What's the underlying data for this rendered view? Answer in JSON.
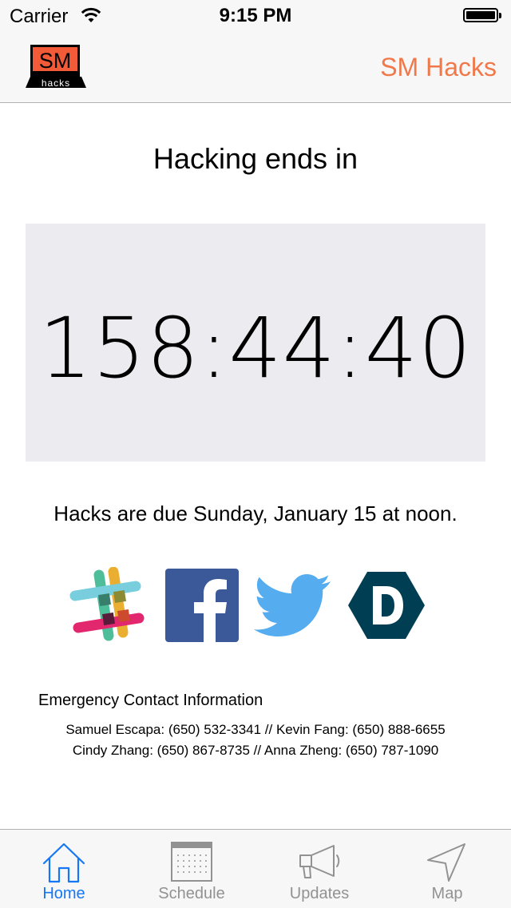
{
  "status_bar": {
    "carrier": "Carrier",
    "time": "9:15 PM"
  },
  "nav": {
    "logo_top": "SM",
    "logo_bottom": "hacks",
    "title": "SM Hacks"
  },
  "main": {
    "heading": "Hacking ends in",
    "countdown": "158:44:40",
    "due_text": "Hacks are due Sunday, January 15 at noon."
  },
  "social": [
    {
      "name": "Slack",
      "icon": "slack-icon"
    },
    {
      "name": "Facebook",
      "icon": "facebook-icon"
    },
    {
      "name": "Twitter",
      "icon": "twitter-icon"
    },
    {
      "name": "Devpost",
      "icon": "devpost-icon"
    }
  ],
  "emergency": {
    "title": "Emergency Contact Information",
    "line1": "Samuel Escapa: (650) 532-3341 // Kevin Fang: (650) 888-6655",
    "line2": "Cindy Zhang: (650) 867-8735 // Anna Zheng: (650) 787-1090"
  },
  "tabs": [
    {
      "label": "Home",
      "icon": "home-icon",
      "active": true
    },
    {
      "label": "Schedule",
      "icon": "calendar-icon",
      "active": false
    },
    {
      "label": "Updates",
      "icon": "megaphone-icon",
      "active": false
    },
    {
      "label": "Map",
      "icon": "location-arrow-icon",
      "active": false
    }
  ],
  "colors": {
    "accent": "#f0784a",
    "tab_active": "#1577f5",
    "tab_inactive": "#929292",
    "timer_bg": "#ebebf0",
    "facebook": "#3b5998",
    "twitter": "#55acee",
    "devpost": "#003e54"
  }
}
